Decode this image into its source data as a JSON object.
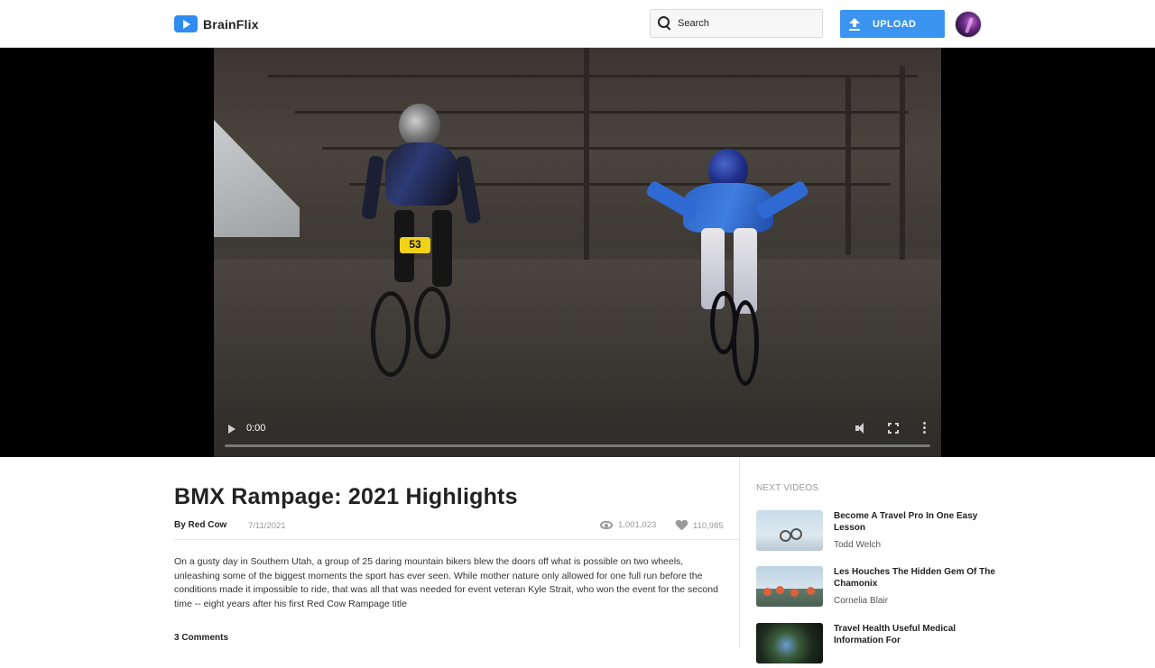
{
  "header": {
    "logo_text": "BrainFlix",
    "search_placeholder": "Search",
    "upload_label": "UPLOAD"
  },
  "player": {
    "time": "0:00",
    "progress": 0,
    "jersey_number": "53"
  },
  "video": {
    "title": "BMX Rampage: 2021 Highlights",
    "author": "By Red Cow",
    "date": "7/11/2021",
    "views": "1,001,023",
    "likes": "110,985",
    "description": "On a gusty day in Southern Utah, a group of 25 daring mountain bikers blew the doors off what is possible on two wheels, unleashing some of the biggest moments the sport has ever seen. While mother nature only allowed for one full run before the conditions made it impossible to ride, that was all that was needed for event veteran Kyle Strait, who won the event for the second time -- eight years after his first Red Cow Rampage title",
    "comments_count": "3 Comments"
  },
  "sidebar": {
    "heading": "NEXT VIDEOS",
    "items": [
      {
        "title": "Become A Travel Pro In One Easy Lesson",
        "author": "Todd Welch"
      },
      {
        "title": "Les Houches The Hidden Gem Of The Chamonix",
        "author": "Cornelia Blair"
      },
      {
        "title": "Travel Health Useful Medical Information For",
        "author": ""
      }
    ]
  },
  "colors": {
    "brand": "#2f8cf0",
    "upload_button": "#3a94f0",
    "muted_text": "#9a9a9a"
  },
  "icons": [
    "play-icon",
    "search-icon",
    "upload-icon",
    "eye-icon",
    "heart-icon",
    "volume-icon",
    "fullscreen-icon",
    "more-icon"
  ]
}
